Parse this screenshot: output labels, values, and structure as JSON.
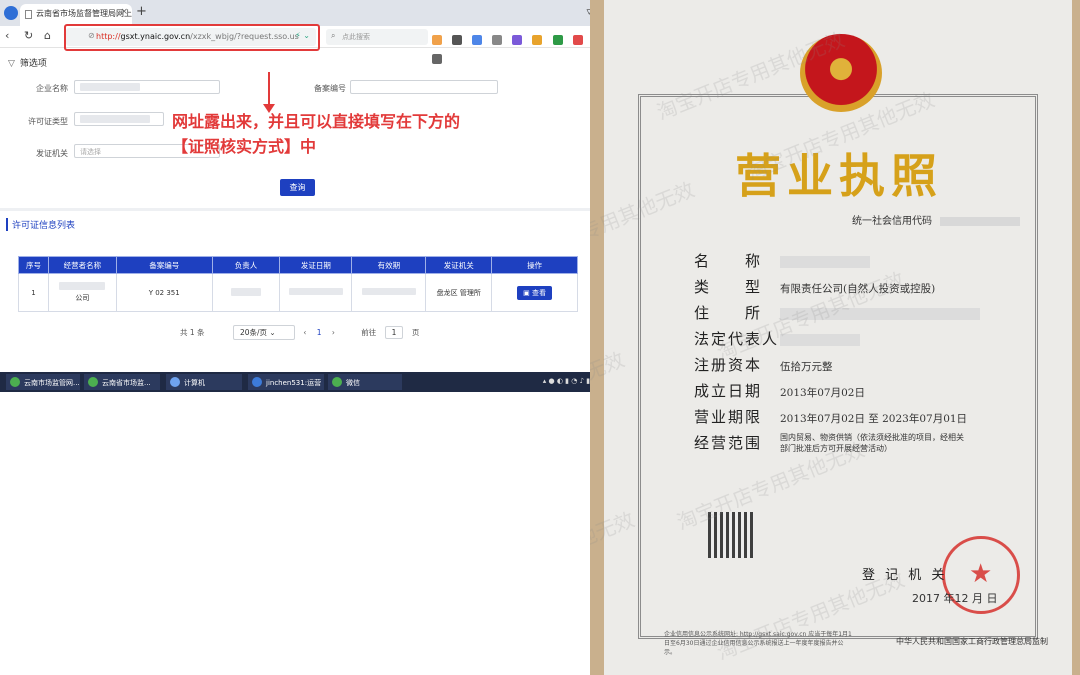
{
  "browser": {
    "tab_title": "云南省市场监督管理局网上办事",
    "url_scheme": "http://",
    "url_host": "gsxt.ynaic.gov.cn",
    "url_path": "/xzxk_wbjg/?request.sso.us",
    "search_placeholder": "点此搜索"
  },
  "filter": {
    "header": "筛选项",
    "company_label": "企业名称",
    "record_label": "备案编号",
    "permit_type_label": "许可证类型",
    "issuer_label": "发证机关",
    "issuer_placeholder": "请选择",
    "query_button": "查询"
  },
  "annotation": {
    "line1": "网址露出来，并且可以直接填写在下方的",
    "line2": "【证照核实方式】中"
  },
  "list": {
    "title": "许可证信息列表",
    "columns": [
      "序号",
      "经营者名称",
      "备案编号",
      "负责人",
      "发证日期",
      "有效期",
      "发证机关",
      "操作"
    ],
    "row": {
      "index": "1",
      "company": "公司",
      "record_no": "Y 02 351",
      "person": "",
      "issue_date": "",
      "valid_until": "",
      "issuer": "盘龙区  管理所",
      "action": "查看"
    }
  },
  "pager": {
    "total": "共 1 条",
    "page_size": "20条/页",
    "current": "1",
    "goto_label": "前往",
    "goto_value": "1",
    "page_suffix": "页"
  },
  "taskbar": {
    "items": [
      "云南市场监管网...",
      "云南省市场监...",
      "计算机",
      "jinchen531:运营 ...",
      "微信"
    ]
  },
  "license": {
    "title": "营业执照",
    "credit_code_label": "统一社会信用代码",
    "fields": [
      {
        "label": "名　　称",
        "value": ""
      },
      {
        "label": "类　　型",
        "value": "有限责任公司(自然人投资或控股)"
      },
      {
        "label": "住　　所",
        "value": ""
      },
      {
        "label": "法定代表人",
        "value": ""
      },
      {
        "label": "注册资本",
        "value": "伍拾万元整"
      },
      {
        "label": "成立日期",
        "value": "2013年07月02日"
      },
      {
        "label": "营业期限",
        "value": "2013年07月02日 至 2023年07月01日"
      },
      {
        "label": "经营范围",
        "value": "国内贸易、物资供销（依法须经批准的项目，经相关部门批准后方可开展经营活动）"
      }
    ],
    "registration_authority": "登 记 机 关",
    "registration_date": "2017 年12 月 日",
    "footer_left": "企业信用信息公示系统网址: http://gsxt.saic.gov.cn 应当于每年1月1日至6月30日通过企业信用信息公示系统报送上一年度年度报告并公示。",
    "footer_right": "中华人民共和国国家工商行政管理总局监制",
    "watermark": "淘宝开店专用其他无效"
  }
}
